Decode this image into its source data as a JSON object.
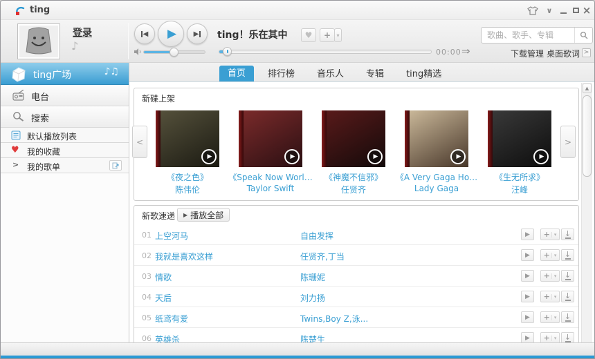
{
  "window": {
    "title": "ting"
  },
  "account": {
    "login": "登录"
  },
  "player": {
    "now_playing": "ting！乐在其中",
    "elapsed": "00:00",
    "volume_percent": 50,
    "progress_percent": 4
  },
  "search": {
    "placeholder": "歌曲、歌手、专辑"
  },
  "quick_links": {
    "download_manager": "下载管理",
    "desktop_lyrics": "桌面歌词"
  },
  "sidebar": {
    "items": [
      {
        "label": "ting广场",
        "active": true
      },
      {
        "label": "电台"
      },
      {
        "label": "搜索"
      },
      {
        "label": "默认播放列表"
      },
      {
        "label": "我的收藏"
      },
      {
        "label": "我的歌单"
      }
    ]
  },
  "tabs": [
    {
      "label": "首页",
      "active": true
    },
    {
      "label": "排行榜"
    },
    {
      "label": "音乐人"
    },
    {
      "label": "专辑"
    },
    {
      "label": "ting精选"
    }
  ],
  "new_albums": {
    "title": "新碟上架",
    "items": [
      {
        "title": "《夜之色》",
        "artist": "陈伟伦",
        "cover_colors": [
          "#56523c",
          "#1b1a12"
        ]
      },
      {
        "title": "《Speak Now Worl…",
        "artist": "Taylor Swift",
        "cover_colors": [
          "#7c2b2b",
          "#2a0f12"
        ]
      },
      {
        "title": "《神魔不信邪》",
        "artist": "任贤齐",
        "cover_colors": [
          "#5a1a1a",
          "#130a0a"
        ]
      },
      {
        "title": "《A Very Gaga Ho…",
        "artist": "Lady Gaga",
        "cover_colors": [
          "#cdbb9c",
          "#48372a"
        ]
      },
      {
        "title": "《生无所求》",
        "artist": "汪峰",
        "cover_colors": [
          "#3a3a3a",
          "#0d0d0d"
        ]
      }
    ]
  },
  "new_songs": {
    "title": "新歌速递",
    "play_all": "播放全部",
    "rows": [
      {
        "num": "01",
        "title": "上空河马",
        "artist": "自由发挥"
      },
      {
        "num": "02",
        "title": "我就是喜欢这样",
        "artist": "任贤齐,丁当"
      },
      {
        "num": "03",
        "title": "情歌",
        "artist": "陈珊妮"
      },
      {
        "num": "04",
        "title": "天后",
        "artist": "刘力扬"
      },
      {
        "num": "05",
        "title": "纸鸢有爱",
        "artist": "Twins,Boy Z,泳..."
      },
      {
        "num": "06",
        "title": "英雄杀",
        "artist": "陈楚生"
      }
    ]
  },
  "icons": {
    "prev": "◀",
    "play": "▶",
    "next": "▶",
    "heart": "♥",
    "add": "+",
    "caret": "▾",
    "mode_arrow": "⇒",
    "download": "↓",
    "carousel_left": "<",
    "carousel_right": ">",
    "scroll_up": "▲",
    "notes": "♪♫",
    "note": "♪",
    "chevron_right": ">",
    "menu_caret": "∨",
    "close": "×",
    "lyrics_chevron": ">"
  },
  "colors": {
    "accent": "#3a9fd3",
    "link": "#3a9fd3",
    "sidebar_header_top": "#8fcdeb",
    "sidebar_header_bottom": "#3a9dd2",
    "bottom_line": "#2b99d4",
    "album_spine": "#7a1717",
    "favorite_heart": "#e03b3b"
  }
}
